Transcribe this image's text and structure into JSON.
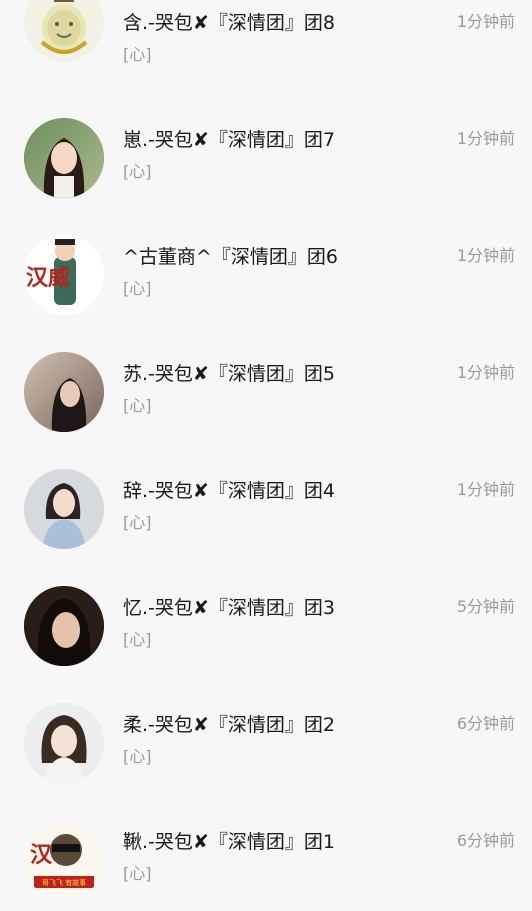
{
  "conversations": [
    {
      "name": "含.-哭包✘『深情团』团8",
      "preview": "[心]",
      "time": "1分钟前"
    },
    {
      "name": "崽.-哭包✘『深情团』团7",
      "preview": "[心]",
      "time": "1分钟前"
    },
    {
      "name": "^古董商^『深情团』团6",
      "preview": "[心]",
      "time": "1分钟前"
    },
    {
      "name": "苏.-哭包✘『深情团』团5",
      "preview": "[心]",
      "time": "1分钟前"
    },
    {
      "name": "辞.-哭包✘『深情团』团4",
      "preview": "[心]",
      "time": "1分钟前"
    },
    {
      "name": "忆.-哭包✘『深情团』团3",
      "preview": "[心]",
      "time": "5分钟前"
    },
    {
      "name": "柔.-哭包✘『深情团』团2",
      "preview": "[心]",
      "time": "6分钟前"
    },
    {
      "name": "鞦.-哭包✘『深情团』团1",
      "preview": "[心]",
      "time": "6分钟前"
    }
  ],
  "avatar_logo_text": {
    "row3": "汉威",
    "row8_top": "汉",
    "row8_banner": "哥飞飞 有故事"
  },
  "colors": {
    "background": "#f7f7f8",
    "name_text": "#1a1a1a",
    "secondary_text": "#9a9a9a",
    "logo_red": "#b3241d"
  }
}
